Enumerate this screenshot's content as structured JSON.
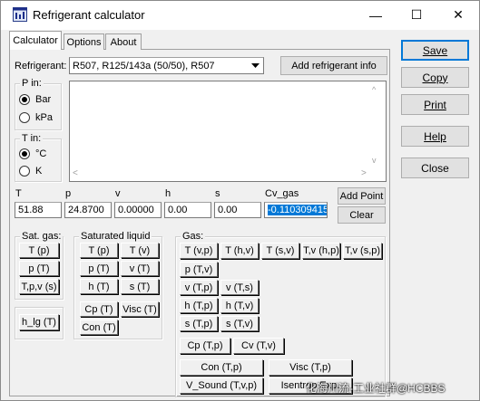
{
  "window": {
    "title": "Refrigerant calculator",
    "minimize_glyph": "—",
    "maximize_glyph": "☐",
    "close_glyph": "✕"
  },
  "tabs": [
    {
      "label": "Calculator",
      "active": true
    },
    {
      "label": "Options",
      "active": false
    },
    {
      "label": "About",
      "active": false
    }
  ],
  "refrigerant": {
    "label": "Refrigerant:",
    "selected": "R507, R125/143a (50/50), R507",
    "add_info_button": "Add refrigerant info"
  },
  "p_in": {
    "title": "P in:",
    "options": [
      "Bar",
      "kPa"
    ],
    "selected": "Bar"
  },
  "t_in": {
    "title": "T in:",
    "options": [
      "°C",
      "K"
    ],
    "selected": "°C"
  },
  "inputs": {
    "labels": [
      "T",
      "p",
      "v",
      "h",
      "s",
      "Cv_gas"
    ],
    "values": [
      "51.88",
      "24.8700",
      "0.00000",
      "0.00",
      "0.00",
      "-0.110309415"
    ]
  },
  "add_point_button": "Add Point",
  "clear_button": "Clear",
  "sat_gas": {
    "title": "Sat. gas:",
    "buttons": [
      "T (p)",
      "p (T)",
      "T,p,v (s)"
    ]
  },
  "h_lg_button": "h_lg (T)",
  "saturated_liquid": {
    "title": "Saturated liquid",
    "buttons": [
      "T (p)",
      "T (v)",
      "p (T)",
      "v (T)",
      "h (T)",
      "s (T)",
      "Cp (T)",
      "Visc (T)",
      "Con (T)"
    ]
  },
  "gas": {
    "title": "Gas:",
    "row1": [
      "T (v,p)",
      "T (h,v)",
      "T (s,v)",
      "T,v (h,p)",
      "T,v (s,p)"
    ],
    "col_left": [
      "p (T,v)",
      "v (T,p)",
      "h (T,p)",
      "s (T,p)"
    ],
    "col_right": [
      "v (T,s)",
      "h (T,v)",
      "s (T,v)"
    ],
    "cp_cv": [
      "Cp (T,p)",
      "Cv (T,v)"
    ],
    "bottom_left": [
      "Con (T,p)",
      "V_Sound (T,v,p)"
    ],
    "bottom_right": [
      "Visc (T,p)",
      "Isentrop Exp."
    ]
  },
  "side_buttons": [
    "Save",
    "Copy",
    "Print",
    "Help",
    "Close"
  ],
  "watermark": "化海川流-工业社群@HCBBS"
}
